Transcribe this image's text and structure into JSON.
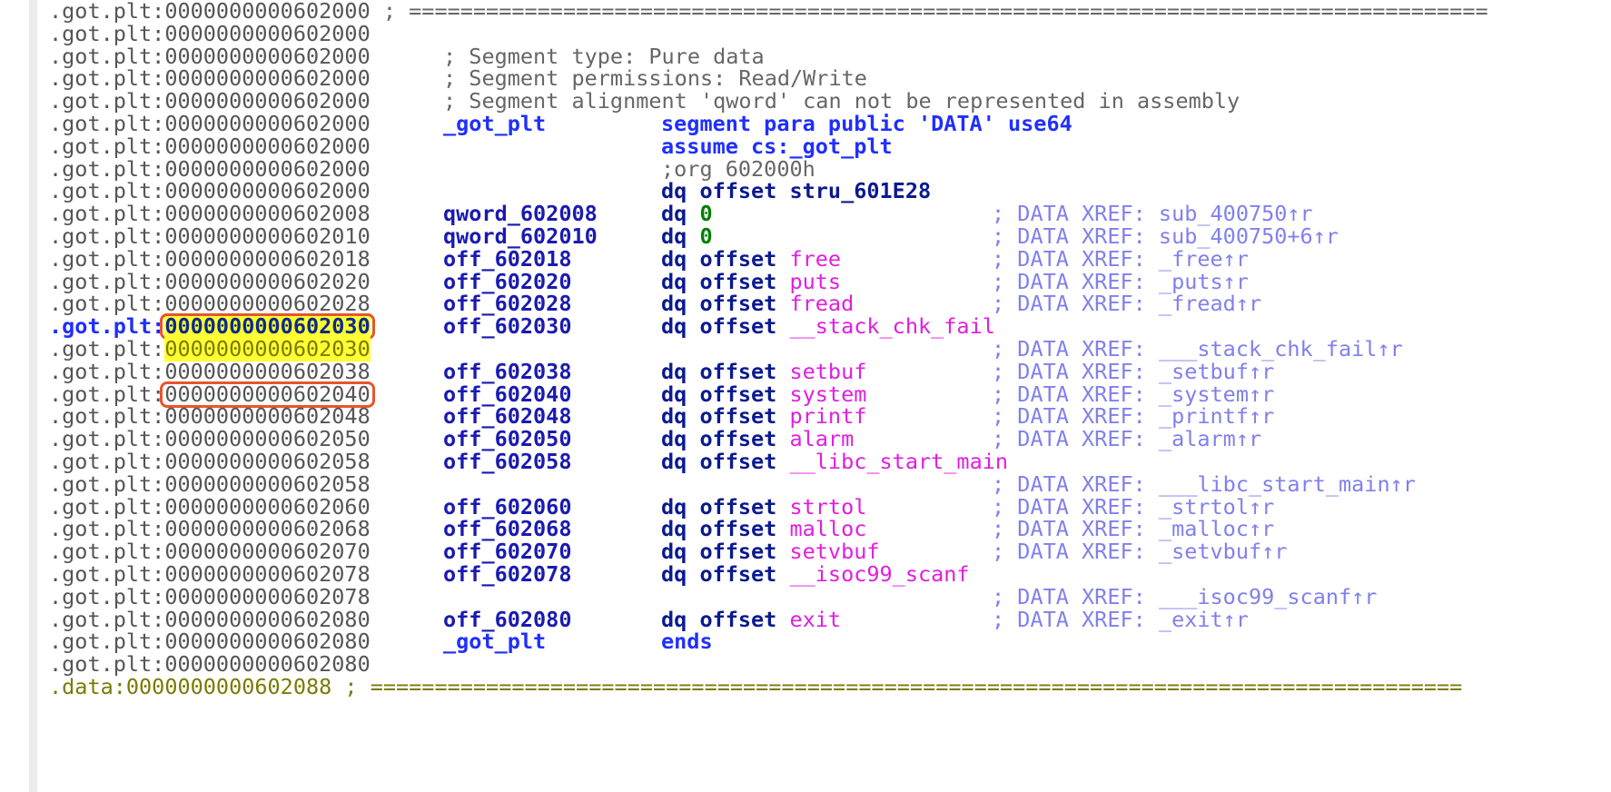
{
  "segment_prefix": ".got.plt",
  "data_prefix": ".data",
  "rows": [
    {
      "addr": "0000000000602000",
      "type": "rule",
      "rule": "; ===================================================================================="
    },
    {
      "addr": "0000000000602000",
      "type": "blank"
    },
    {
      "addr": "0000000000602000",
      "type": "comment",
      "text": "; Segment type: Pure data"
    },
    {
      "addr": "0000000000602000",
      "type": "comment",
      "text": "; Segment permissions: Read/Write"
    },
    {
      "addr": "0000000000602000",
      "type": "comment",
      "text": "; Segment alignment 'qword' can not be represented in assembly"
    },
    {
      "addr": "0000000000602000",
      "type": "code",
      "label": "_got_plt",
      "label_style": "blue",
      "ins": "segment para public 'DATA' use64",
      "ins_style": "segment"
    },
    {
      "addr": "0000000000602000",
      "type": "code",
      "label": "",
      "ins": "assume cs:_got_plt",
      "ins_style": "segment"
    },
    {
      "addr": "0000000000602000",
      "type": "org",
      "text": ";org 602000h"
    },
    {
      "addr": "0000000000602000",
      "type": "code",
      "dot": true,
      "label": "",
      "ins": "dq offset",
      "target": "stru_601E28",
      "target_style": "plain"
    },
    {
      "addr": "0000000000602008",
      "type": "code",
      "dot": true,
      "label": "qword_602008",
      "ins": "dq",
      "target": "0",
      "target_style": "num",
      "xref": "; DATA XREF: sub_400750↑r"
    },
    {
      "addr": "0000000000602010",
      "type": "code",
      "dot": true,
      "label": "qword_602010",
      "ins": "dq",
      "target": "0",
      "target_style": "num",
      "xref": "; DATA XREF: sub_400750+6↑r"
    },
    {
      "addr": "0000000000602018",
      "type": "code",
      "dot": true,
      "label": "off_602018",
      "ins": "dq offset",
      "target": "free",
      "target_style": "fn",
      "xref": "; DATA XREF: _free↑r"
    },
    {
      "addr": "0000000000602020",
      "type": "code",
      "dot": true,
      "label": "off_602020",
      "ins": "dq offset",
      "target": "puts",
      "target_style": "fn",
      "xref": "; DATA XREF: _puts↑r"
    },
    {
      "addr": "0000000000602028",
      "type": "code",
      "dot": true,
      "label": "off_602028",
      "ins": "dq offset",
      "target": "fread",
      "target_style": "fn",
      "xref": "; DATA XREF: _fread↑r"
    },
    {
      "addr": "0000000000602030",
      "type": "code",
      "dot": true,
      "current": true,
      "selected": true,
      "label": "off_602030",
      "ins": "dq offset",
      "target": "__stack_chk_fail",
      "target_style": "fn"
    },
    {
      "addr": "0000000000602030",
      "type": "xref_only",
      "highlight": true,
      "xref": "; DATA XREF: ___stack_chk_fail↑r"
    },
    {
      "addr": "0000000000602038",
      "type": "code",
      "dot": true,
      "label": "off_602038",
      "ins": "dq offset",
      "target": "setbuf",
      "target_style": "fn",
      "xref": "; DATA XREF: _setbuf↑r"
    },
    {
      "addr": "0000000000602040",
      "type": "code",
      "dot": true,
      "boxed": true,
      "label": "off_602040",
      "ins": "dq offset",
      "target": "system",
      "target_style": "fn",
      "xref": "; DATA XREF: _system↑r"
    },
    {
      "addr": "0000000000602048",
      "type": "code",
      "dot": true,
      "label": "off_602048",
      "ins": "dq offset",
      "target": "printf",
      "target_style": "fn",
      "xref": "; DATA XREF: _printf↑r"
    },
    {
      "addr": "0000000000602050",
      "type": "code",
      "dot": true,
      "label": "off_602050",
      "ins": "dq offset",
      "target": "alarm",
      "target_style": "fn",
      "xref": "; DATA XREF: _alarm↑r"
    },
    {
      "addr": "0000000000602058",
      "type": "code",
      "label": "off_602058",
      "ins": "dq offset",
      "target": "__libc_start_main",
      "target_style": "fn"
    },
    {
      "addr": "0000000000602058",
      "type": "xref_only",
      "xref": "; DATA XREF: ___libc_start_main↑r"
    },
    {
      "addr": "0000000000602060",
      "type": "code",
      "dot": true,
      "label": "off_602060",
      "ins": "dq offset",
      "target": "strtol",
      "target_style": "fn",
      "xref": "; DATA XREF: _strtol↑r"
    },
    {
      "addr": "0000000000602068",
      "type": "code",
      "dot": true,
      "label": "off_602068",
      "ins": "dq offset",
      "target": "malloc",
      "target_style": "fn",
      "xref": "; DATA XREF: _malloc↑r"
    },
    {
      "addr": "0000000000602070",
      "type": "code",
      "dot": true,
      "label": "off_602070",
      "ins": "dq offset",
      "target": "setvbuf",
      "target_style": "fn",
      "xref": "; DATA XREF: _setvbuf↑r"
    },
    {
      "addr": "0000000000602078",
      "type": "code",
      "dot": true,
      "label": "off_602078",
      "ins": "dq offset",
      "target": "__isoc99_scanf",
      "target_style": "fn"
    },
    {
      "addr": "0000000000602078",
      "type": "xref_only",
      "hollow": true,
      "xref": "; DATA XREF: ___isoc99_scanf↑r"
    },
    {
      "addr": "0000000000602080",
      "type": "code",
      "dot": true,
      "label": "off_602080",
      "ins": "dq offset",
      "target": "exit",
      "target_style": "fn",
      "xref": "; DATA XREF: _exit↑r"
    },
    {
      "addr": "0000000000602080",
      "type": "code",
      "label": "_got_plt",
      "label_style": "blue",
      "ins": "ends",
      "ins_style": "segment"
    },
    {
      "addr": "0000000000602080",
      "type": "blank"
    },
    {
      "addr": "0000000000602088",
      "type": "rule",
      "data_segment": true,
      "rule": "; ====================================================================================="
    }
  ],
  "colors": {
    "function_name": "#e01ee0",
    "keyword": "#1f2fff",
    "xref": "#8080ee",
    "highlight": "#ffff33",
    "annotation_box": "#e8552c",
    "number": "#008000"
  }
}
